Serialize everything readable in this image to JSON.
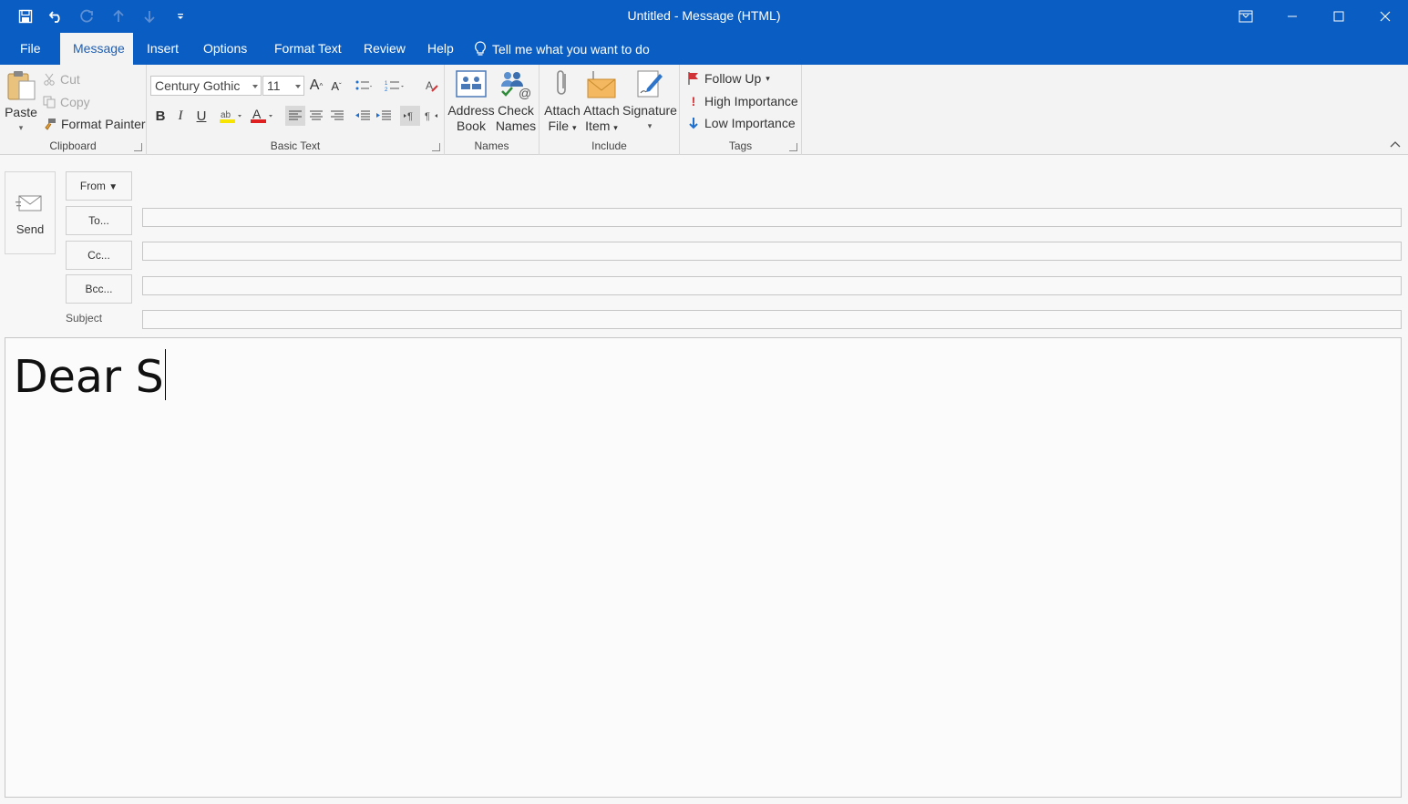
{
  "window": {
    "title": "Untitled  -  Message (HTML)"
  },
  "tabs": [
    {
      "label": "File"
    },
    {
      "label": "Message"
    },
    {
      "label": "Insert"
    },
    {
      "label": "Options"
    },
    {
      "label": "Format Text"
    },
    {
      "label": "Review"
    },
    {
      "label": "Help"
    }
  ],
  "tell_me": "Tell me what you want to do",
  "ribbon": {
    "clipboard": {
      "paste": "Paste",
      "cut": "Cut",
      "copy": "Copy",
      "format_painter": "Format Painter",
      "label": "Clipboard"
    },
    "basic_text": {
      "font": "Century Gothic",
      "size": "11",
      "bold": "B",
      "italic": "I",
      "underline": "U",
      "label": "Basic Text"
    },
    "names": {
      "address_book_1": "Address",
      "address_book_2": "Book",
      "check_names_1": "Check",
      "check_names_2": "Names",
      "label": "Names"
    },
    "include": {
      "attach_file_1": "Attach",
      "attach_file_2": "File",
      "attach_item_1": "Attach",
      "attach_item_2": "Item",
      "signature": "Signature",
      "label": "Include"
    },
    "tags": {
      "follow_up": "Follow Up",
      "high": "High Importance",
      "low": "Low Importance",
      "label": "Tags"
    }
  },
  "compose": {
    "send": "Send",
    "from": "From",
    "to": "To...",
    "cc": "Cc...",
    "bcc": "Bcc...",
    "subject_label": "Subject",
    "to_value": "",
    "cc_value": "",
    "bcc_value": "",
    "subject_value": "",
    "body_text": "Dear S"
  },
  "colors": {
    "accent": "#0a5dc2",
    "ribbon": "#f3f3f3",
    "flag": "#d13438",
    "high": "#d13438",
    "low": "#1e6fd0"
  }
}
